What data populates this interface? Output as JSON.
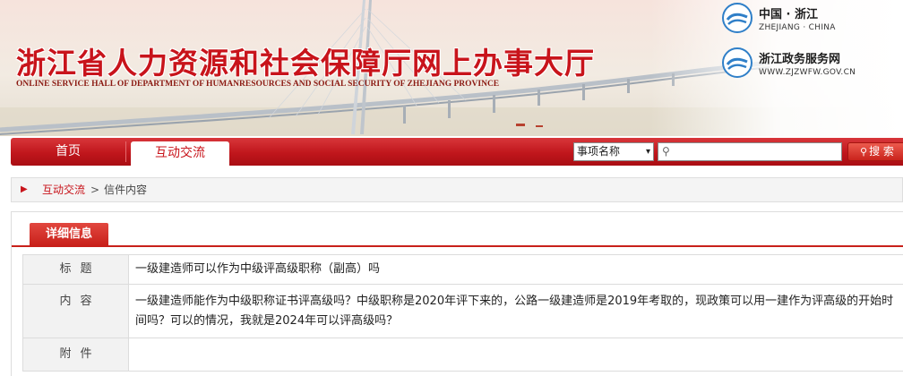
{
  "header": {
    "title": "浙江省人力资源和社会保障厅网上办事大厅",
    "subtitle": "ONLINE SERVICE HALL OF DEPARTMENT OF HUMANRESOURCES AND SOCIAL SECURITY OF ZHEJIANG PROVINCE",
    "gov_portal": {
      "name": "中国 · 浙江",
      "sub": "ZHEJIANG · CHINA",
      "icon": "zhejiang-emblem-icon"
    },
    "service_portal": {
      "name": "浙江政务服务网",
      "sub": "WWW.ZJZWFW.GOV.CN",
      "icon": "zjzwfw-logo-icon"
    }
  },
  "nav": {
    "items": [
      {
        "label": "首页",
        "active": false
      },
      {
        "label": "互动交流",
        "active": true
      }
    ],
    "search": {
      "select_value": "事项名称",
      "input_value": "",
      "button_label": "搜 索",
      "icon": "search-icon"
    }
  },
  "breadcrumb": {
    "link": "互动交流",
    "separator": ">",
    "current": "信件内容"
  },
  "detail": {
    "tab_label": "详细信息",
    "rows": [
      {
        "label": "标题",
        "value": "一级建造师可以作为中级评高级职称（副高）吗"
      },
      {
        "label": "内容",
        "value": "一级建造师能作为中级职称证书评高级吗？中级职称是2020年评下来的，公路一级建造师是2019年考取的，现政策可以用一建作为评高级的开始时间吗？可以的情况，我就是2024年可以评高级吗？"
      },
      {
        "label": "附件",
        "value": ""
      }
    ]
  },
  "colors": {
    "brand_red": "#c8141b",
    "nav_red": "#c0161c",
    "label_bg": "#f2f2f2"
  }
}
